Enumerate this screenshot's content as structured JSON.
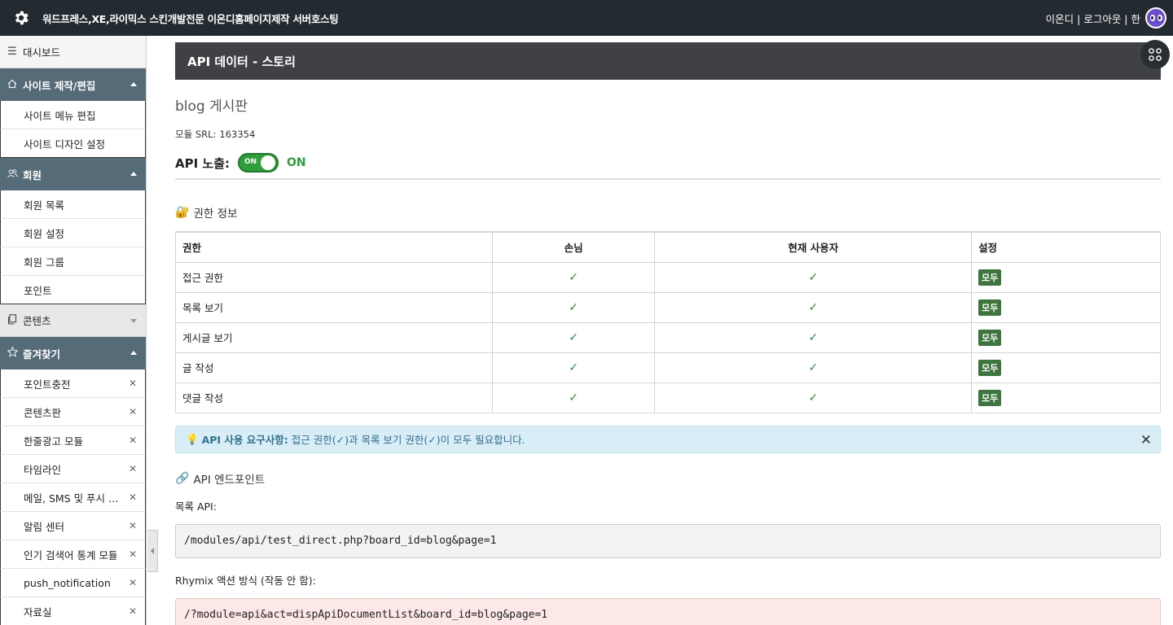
{
  "header": {
    "site_title": "워드프레스,XE,라이믹스 스킨개발전문 이온디홈페이지제작 서버호스팅",
    "user_links": "이온디 | 로그아웃 | 한"
  },
  "sidebar": {
    "dashboard": "대시보드",
    "groups": [
      {
        "label": "사이트 제작/편집",
        "items": [
          "사이트 메뉴 편집",
          "사이트 디자인 설정"
        ]
      },
      {
        "label": "회원",
        "items": [
          "회원 목록",
          "회원 설정",
          "회원 그룹",
          "포인트"
        ]
      },
      {
        "label": "콘텐츠",
        "items": []
      },
      {
        "label": "즐겨찾기",
        "items": [
          "포인트충전",
          "콘텐츠판",
          "한줄광고 모듈",
          "타임라인",
          "메일, SMS 및 푸시 알림 관리",
          "알림 센터",
          "인기 검색어 통계 모듈",
          "push_notification",
          "자료실"
        ]
      }
    ]
  },
  "main": {
    "title": "API 데이터 - 스토리",
    "board_name": "blog 게시판",
    "srl_label": "모듈 SRL:",
    "srl_value": "163354",
    "api_expose_label": "API 노출:",
    "toggle_text": "ON",
    "api_state": "ON",
    "perm_section_emoji": "🔐",
    "perm_section_title": "권한 정보",
    "perm_table": {
      "headers": [
        "권한",
        "손님",
        "현재 사용자",
        "설정"
      ],
      "rows": [
        {
          "name": "접근 권한",
          "guest": "✓",
          "current": "✓",
          "setting": "모두"
        },
        {
          "name": "목록 보기",
          "guest": "✓",
          "current": "✓",
          "setting": "모두"
        },
        {
          "name": "게시글 보기",
          "guest": "✓",
          "current": "✓",
          "setting": "모두"
        },
        {
          "name": "글 작성",
          "guest": "✓",
          "current": "✓",
          "setting": "모두"
        },
        {
          "name": "댓글 작성",
          "guest": "✓",
          "current": "✓",
          "setting": "모두"
        }
      ]
    },
    "alert": {
      "bulb": "💡",
      "strong": "API 사용 요구사항:",
      "text": "접근 권한(✓)과 목록 보기 권한(✓)이 모두 필요합니다."
    },
    "endpoint_emoji": "🔗",
    "endpoint_title": "API 엔드포인트",
    "list_api_label": "목록 API:",
    "list_api_url": "/modules/api/test_direct.php?board_id=blog&page=1",
    "rhymix_label": "Rhymix 액션 방식 (작동 안 함):",
    "rhymix_url": "/?module=api&act=dispApiDocumentList&board_id=blog&page=1"
  },
  "colors": {
    "header_bg": "#232b31",
    "sidebar_group_bg": "#566b78",
    "toggle_green": "#2e9e3a",
    "badge_green": "#3c763d",
    "alert_bg": "#d9edf7"
  },
  "icons": [
    "gear-icon",
    "avatar",
    "hamburger-icon",
    "home-icon",
    "users-icon",
    "copy-icon",
    "star-icon",
    "close-icon",
    "apps-grid-icon"
  ]
}
